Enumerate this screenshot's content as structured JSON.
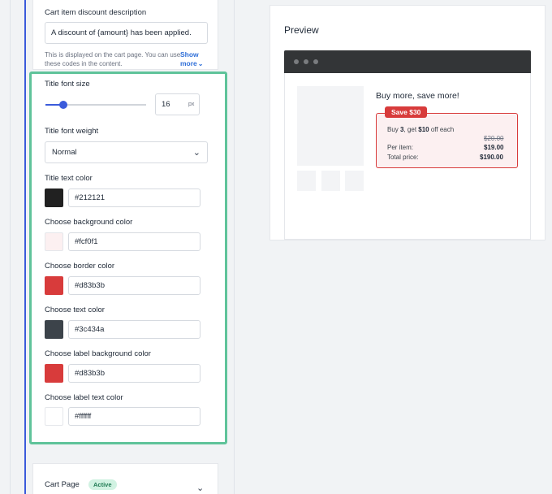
{
  "left_panel": {
    "discount": {
      "label": "Cart item discount description",
      "value": "A discount of {amount} has been applied.",
      "help": "This is displayed on the cart page. You can use these codes in the content.",
      "show_more": "Show more"
    },
    "title_font_size": {
      "label": "Title font size",
      "value": "16",
      "unit": "px",
      "slider_fraction": 0.18
    },
    "title_font_weight": {
      "label": "Title font weight",
      "value": "Normal"
    },
    "colors": [
      {
        "label": "Title text color",
        "value": "#212121",
        "swatch": "#212121"
      },
      {
        "label": "Choose background color",
        "value": "#fcf0f1",
        "swatch": "#fcf0f1"
      },
      {
        "label": "Choose border color",
        "value": "#d83b3b",
        "swatch": "#d83b3b"
      },
      {
        "label": "Choose text color",
        "value": "#3c434a",
        "swatch": "#3c434a"
      },
      {
        "label": "Choose label background color",
        "value": "#d83b3b",
        "swatch": "#d83b3b"
      },
      {
        "label": "Choose label text color",
        "value": "#ffffff",
        "swatch": "#ffffff"
      }
    ],
    "cart_page": {
      "label": "Cart Page",
      "badge": "Active"
    }
  },
  "preview": {
    "title": "Preview",
    "product_title": "Buy more, save more!",
    "badge": "Save $30",
    "offer_pre": "Buy ",
    "offer_qty": "3",
    "offer_mid": ", get ",
    "offer_amount": "$10",
    "offer_post": " off each",
    "original_price": "$20.00",
    "per_item_label": "Per item:",
    "per_item_value": "$19.00",
    "total_label": "Total price:",
    "total_value": "$190.00"
  }
}
